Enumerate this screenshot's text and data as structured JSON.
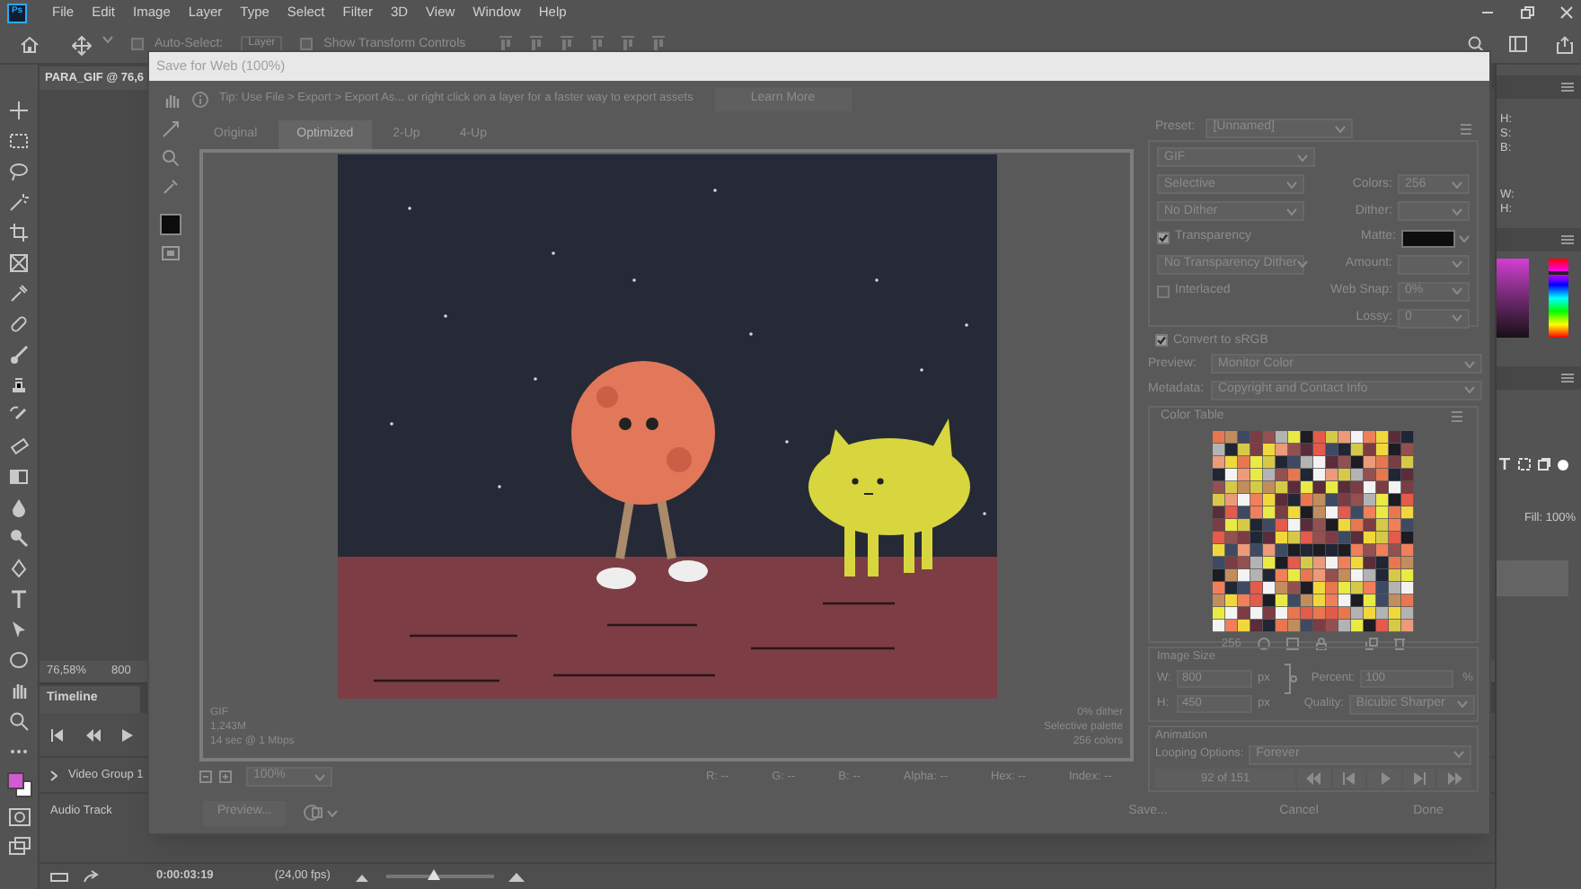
{
  "app_logo": "Ps",
  "menu": [
    "File",
    "Edit",
    "Image",
    "Layer",
    "Type",
    "Select",
    "Filter",
    "3D",
    "View",
    "Window",
    "Help"
  ],
  "options_bar": {
    "auto_select": {
      "label": "Auto-Select:",
      "checked": false
    },
    "target": "Layer",
    "transform_controls": {
      "label": "Show Transform Controls",
      "checked": false
    }
  },
  "document_tab": "PARA_GIF @ 76,6",
  "canvas_status": {
    "zoom": "76,58%",
    "size": "800"
  },
  "timeline": {
    "tab": "Timeline",
    "tracks": [
      "Video Group 1",
      "Audio Track"
    ],
    "current_time": "0:00:03:19",
    "frame_rate": "(24,00 fps)",
    "zoom_slider": {
      "level": 0.45
    }
  },
  "side_panels": {
    "color_labels": [
      "H:",
      "S:",
      "B:"
    ],
    "size_labels": [
      "W:",
      "H:"
    ],
    "fill": "Fill: 100%",
    "hue_slider": {
      "level": 0.82
    }
  },
  "dialog": {
    "title": "Save for Web (100%)",
    "tip": "Tip: Use File > Export > Export As... or right click on a layer for a faster way to export assets",
    "learn_more": "Learn More",
    "tabs": [
      {
        "label": "Original",
        "selected": false
      },
      {
        "label": "Optimized",
        "selected": true
      },
      {
        "label": "2-Up",
        "selected": false
      },
      {
        "label": "4-Up",
        "selected": false
      }
    ],
    "preview_info_left": [
      "GIF",
      "1,243M",
      "14 sec @ 1 Mbps"
    ],
    "preview_info_right": [
      "0% dither",
      "Selective palette",
      "256 colors"
    ],
    "zoom": "100%",
    "readouts": [
      "R: --",
      "G: --",
      "B: --",
      "Alpha: --",
      "Hex: --",
      "Index: --"
    ],
    "preset": {
      "label": "Preset:",
      "value": "[Unnamed]"
    },
    "format": "GIF",
    "settings": [
      {
        "left": {
          "kind": "select",
          "value": "Selective"
        },
        "right": {
          "label": "Colors:",
          "kind": "select",
          "value": "256"
        }
      },
      {
        "left": {
          "kind": "select",
          "value": "No Dither"
        },
        "right": {
          "label": "Dither:",
          "kind": "select"
        }
      },
      {
        "left": {
          "kind": "checkbox",
          "label": "Transparency",
          "checked": true
        },
        "right": {
          "label": "Matte:",
          "kind": "swatch"
        }
      },
      {
        "left": {
          "kind": "select",
          "value": "No Transparency Dither"
        },
        "right": {
          "label": "Amount:",
          "kind": "select"
        }
      },
      {
        "left": {
          "kind": "checkbox",
          "label": "Interlaced",
          "checked": false
        },
        "right": {
          "label": "Web Snap:",
          "kind": "select",
          "value": "0%"
        }
      },
      {
        "right": {
          "label": "Lossy:",
          "kind": "select",
          "value": "0"
        }
      }
    ],
    "convert_srgb": {
      "label": "Convert to sRGB",
      "checked": true
    },
    "preview": {
      "label": "Preview:",
      "value": "Monitor Color"
    },
    "metadata": {
      "label": "Metadata:",
      "value": "Copyright and Contact Info"
    },
    "color_table": {
      "title": "Color Table",
      "count": "256"
    },
    "image_size": {
      "title": "Image Size",
      "width": {
        "label": "W:",
        "value": "800",
        "unit": "px"
      },
      "height": {
        "label": "H:",
        "value": "450",
        "unit": "px"
      },
      "percent": {
        "label": "Percent:",
        "value": "100",
        "unit": "%"
      },
      "quality": {
        "label": "Quality:",
        "value": "Bicubic Sharper"
      }
    },
    "animation": {
      "title": "Animation",
      "looping": {
        "label": "Looping Options:",
        "value": "Forever"
      },
      "frame": "92 of 151"
    },
    "buttons": {
      "preview": "Preview...",
      "save": "Save...",
      "cancel": "Cancel",
      "done": "Done"
    }
  }
}
